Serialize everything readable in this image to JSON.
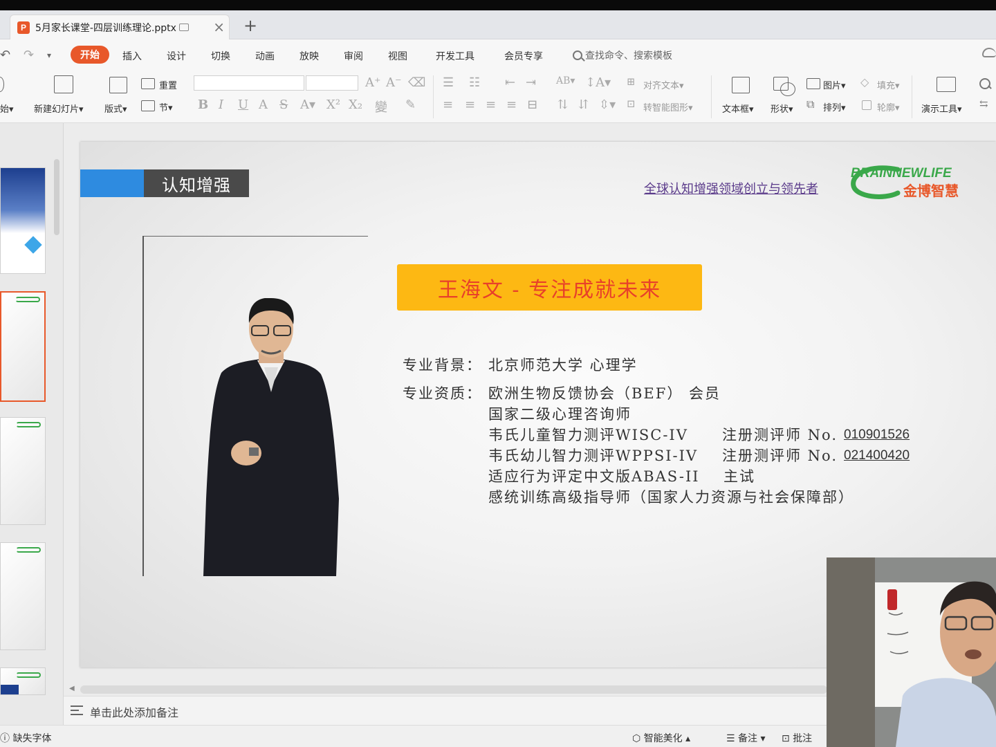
{
  "window": {
    "doc_tab_title": "5月家长课堂-四层训练理论.pptx",
    "ppt_badge": "P"
  },
  "menu": {
    "active": "开始",
    "items": [
      "插入",
      "设计",
      "切换",
      "动画",
      "放映",
      "审阅",
      "视图",
      "开发工具",
      "会员专享"
    ],
    "search_placeholder": "查找命令、搜索模板"
  },
  "ribbon": {
    "start_label": "始",
    "new_slide": "新建幻灯片",
    "layout": "版式",
    "reset": "重置",
    "section": "节",
    "align_text": "对齐文本",
    "to_smartart": "转智能图形",
    "textbox": "文本框",
    "shape": "形状",
    "picture": "图片",
    "arrange": "排列",
    "fill": "填充",
    "outline": "轮廓",
    "presentation_tools": "演示工具"
  },
  "slide": {
    "header_label": "认知增强",
    "tagline": "全球认知增强领域创立与领先者",
    "logo_en": "BRAINNEWLIFE",
    "logo_cn": "金博智慧",
    "banner": "王海文 - 专注成就未来",
    "bio": {
      "bg_label": "专业背景：",
      "bg_value": "北京师范大学 心理学",
      "qual_label": "专业资质：",
      "q1": "欧洲生物反馈协会（BEF） 会员",
      "q2": "国家二级心理咨询师",
      "q3": "韦氏儿童智力测评WISC-IV",
      "q3_reg": "注册测评师 No.",
      "q3_no": "010901526",
      "q4": "韦氏幼儿智力测评WPPSI-IV",
      "q4_reg": "注册测评师 No.",
      "q4_no": "021400420",
      "q5": "适应行为评定中文版ABAS-II",
      "q5_role": "主试",
      "q6": "感统训练高级指导师（国家人力资源与社会保障部）"
    }
  },
  "notes": {
    "placeholder": "单击此处添加备注"
  },
  "status": {
    "missing_fonts": "缺失字体",
    "beautify": "智能美化",
    "notes_btn": "备注",
    "comment_btn": "批注"
  },
  "colors": {
    "accent": "#e8582a",
    "banner": "#fdb813",
    "banner_text": "#e8402a",
    "header_blue": "#2e8be0",
    "logo_green": "#3aa84a"
  }
}
